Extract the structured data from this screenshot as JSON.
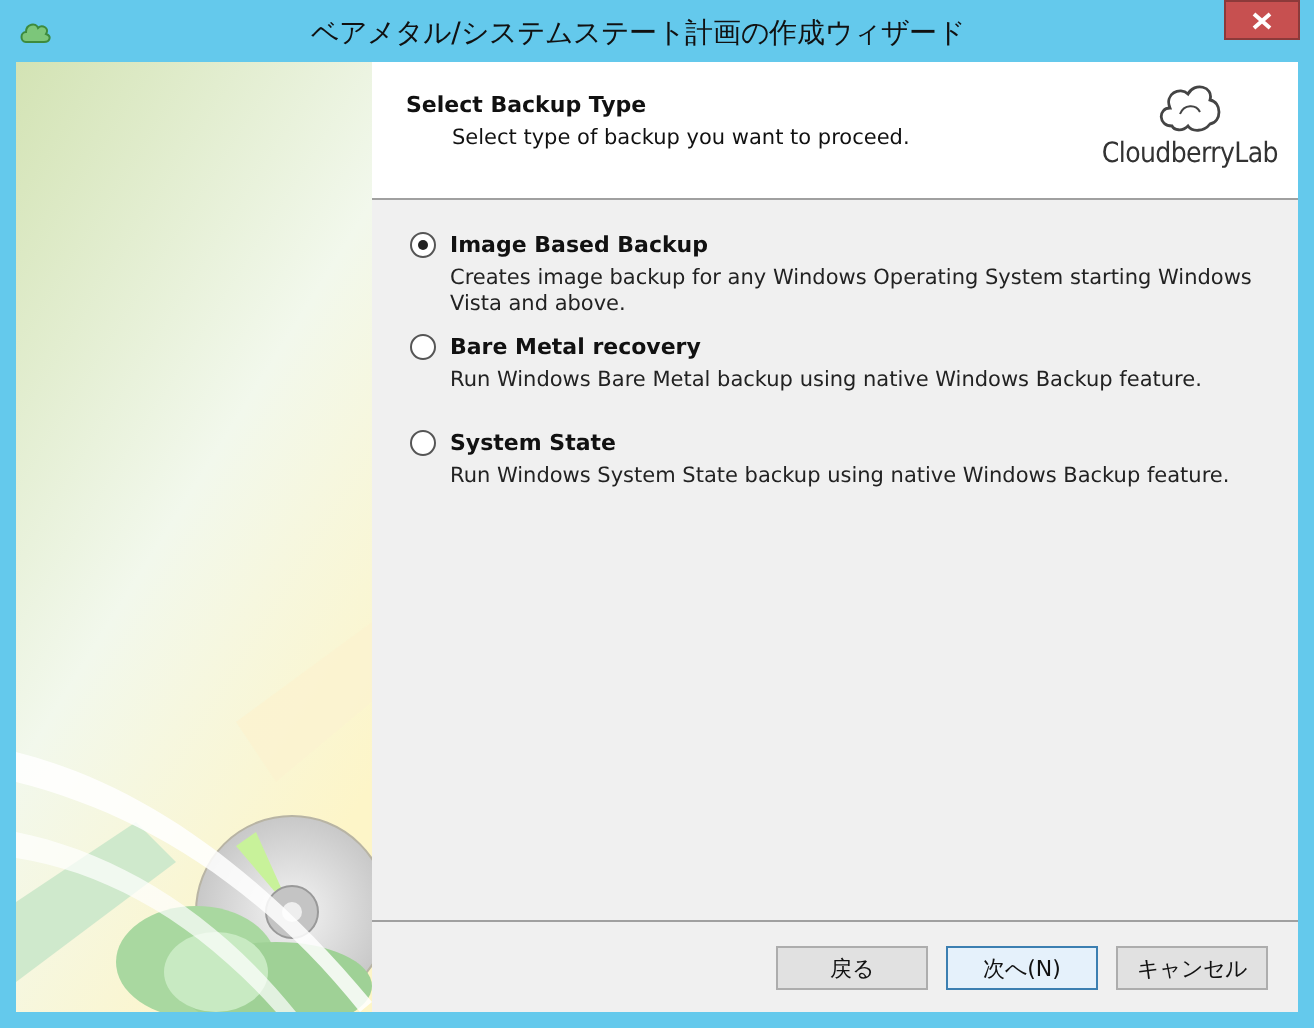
{
  "window": {
    "title": "ベアメタル/システムステート計画の作成ウィザード"
  },
  "header": {
    "title": "Select Backup Type",
    "subtitle": "Select type of backup you want to proceed.",
    "logo_text": "CloudberryLab"
  },
  "options": [
    {
      "label": "Image Based Backup",
      "description": "Creates image backup for any Windows Operating System starting Windows Vista and above.",
      "selected": true
    },
    {
      "label": "Bare Metal recovery",
      "description": "Run Windows Bare Metal backup using native Windows Backup feature.",
      "selected": false
    },
    {
      "label": "System State",
      "description": "Run Windows System State backup using native Windows Backup feature.",
      "selected": false
    }
  ],
  "buttons": [
    {
      "label": "戻る",
      "default": false
    },
    {
      "label": "次へ(N)",
      "default": true
    },
    {
      "label": "キャンセル",
      "default": false
    }
  ]
}
